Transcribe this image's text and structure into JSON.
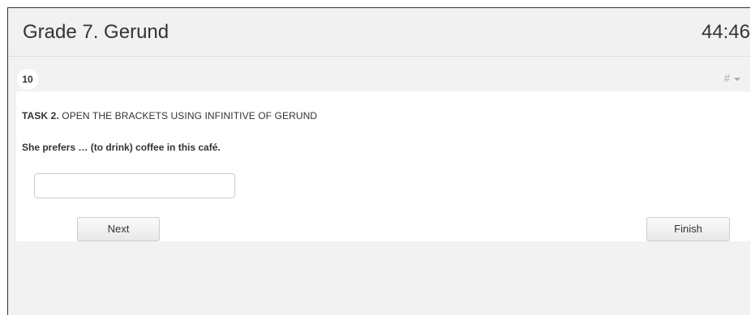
{
  "header": {
    "title": "Grade 7. Gerund",
    "timer": "44:46"
  },
  "question_bar": {
    "number": "10",
    "menu_label": "#"
  },
  "task": {
    "prefix": "TASK 2.",
    "text": " OPEN THE BRACKETS USING INFINITIVE OF GERUND"
  },
  "question": {
    "text": "She prefers … (to drink) coffee in this café."
  },
  "answer": {
    "value": "",
    "placeholder": ""
  },
  "buttons": {
    "next_label": "Next",
    "finish_label": "Finish"
  },
  "icons": {
    "menu_caret": "caret-down-icon"
  }
}
